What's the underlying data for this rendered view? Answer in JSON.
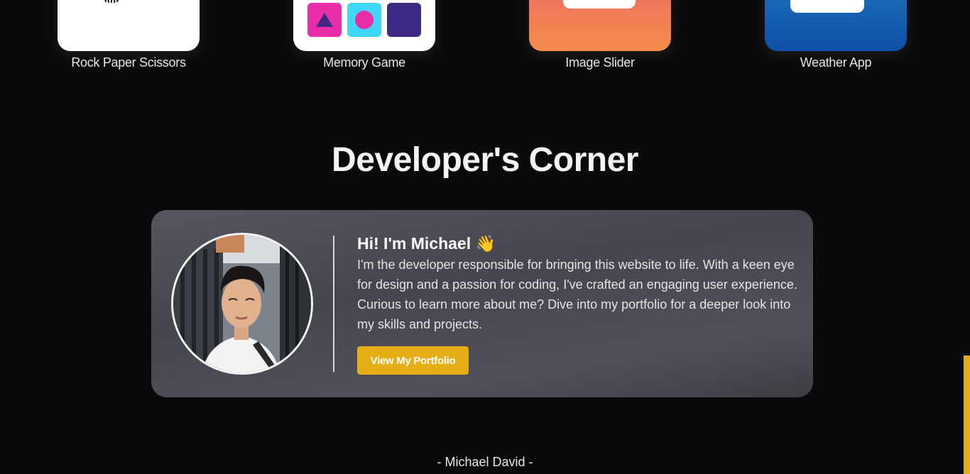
{
  "projects": [
    {
      "label": "Rock Paper Scissors",
      "icon": "rock-paper-scissors-icon"
    },
    {
      "label": "Memory Game",
      "icon": "memory-game-icon"
    },
    {
      "label": "Image Slider",
      "icon": "image-slider-icon"
    },
    {
      "label": "Weather App",
      "icon": "weather-app-icon"
    }
  ],
  "section": {
    "title": "Developer's Corner"
  },
  "developer": {
    "greeting": "Hi! I'm Michael 👋",
    "bio": "I'm the developer responsible for bringing this website to life. With a keen eye for design and a passion for coding, I've crafted an engaging user experience. Curious to learn more about me? Dive into my portfolio for a deeper look into my skills and projects.",
    "button_label": "View My Portfolio",
    "avatar": "developer-avatar"
  },
  "footer": {
    "signature": "- Michael David -"
  },
  "colors": {
    "background": "#0a0a0c",
    "accent": "#e5ae14",
    "card": "#4a4b52",
    "memory_pink": "#ea2ea9",
    "memory_cyan": "#3fd7f3",
    "memory_purple": "#3e2a84"
  }
}
